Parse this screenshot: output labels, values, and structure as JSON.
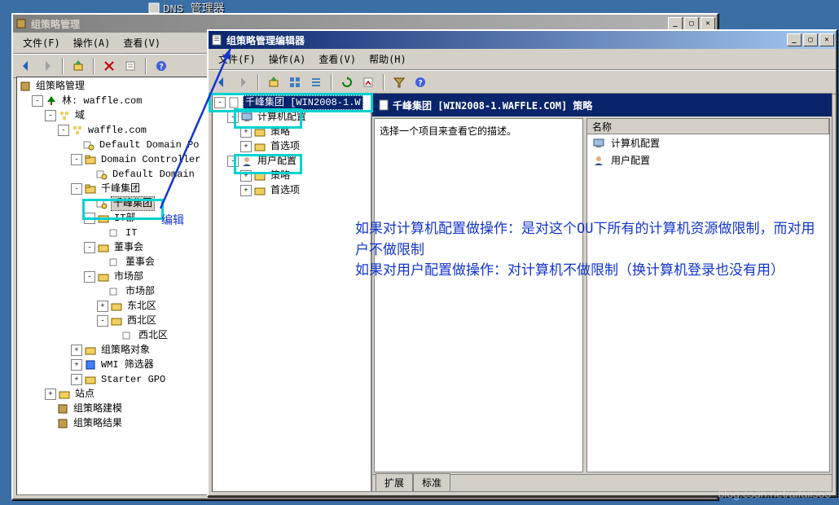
{
  "dns_peek": "DNS 管理器",
  "win_gpmc": {
    "title": "组策略管理",
    "menus": [
      "文件(F)",
      "操作(A)",
      "查看(V)"
    ],
    "tree_root": "组策略管理",
    "forest": "林: waffle.com",
    "domains": "域",
    "domain": "waffle.com",
    "ddp": "Default Domain Po",
    "dc_ou": "Domain Controller",
    "dc_policy": "Default Domain",
    "qf_ou": "千峰集团",
    "qf_gpo": "千峰集团",
    "it_ou": "IT部",
    "it_sub": "IT",
    "dsh_ou": "董事会",
    "dsh_sub": "董事会",
    "scb_ou": "市场部",
    "scb_sub": "市场部",
    "dbq_ou": "东北区",
    "xbq_ou": "西北区",
    "xbq_sub": "西北区",
    "gpo_folder": "组策略对象",
    "wmi": "WMI 筛选器",
    "starter": "Starter GPO",
    "sites": "站点",
    "modeling": "组策略建模",
    "results": "组策略结果"
  },
  "win_gpedit": {
    "title": "组策略管理编辑器",
    "menus": [
      "文件(F)",
      "操作(A)",
      "查看(V)",
      "帮助(H)"
    ],
    "tree_root": "千峰集团 [WIN2008-1.W",
    "cc_node": "计算机配置",
    "cc_policies": "策略",
    "cc_prefs": "首选项",
    "uc_node": "用户配置",
    "uc_policies": "策略",
    "uc_prefs": "首选项",
    "header": "千峰集团 [WIN2008-1.WAFFLE.COM] 策略",
    "desc_text": "选择一个项目来查看它的描述。",
    "col_name": "名称",
    "item_cc": "计算机配置",
    "item_uc": "用户配置",
    "tab_ext": "扩展",
    "tab_std": "标准"
  },
  "annotations": {
    "edit_label": "编辑",
    "text1": "如果对计算机配置做操作：是对这个OU下所有的计算机资源做限制，而对用户不做限制",
    "text2": "如果对用户配置做操作：对计算机不做限制（换计算机登录也没有用）"
  },
  "watermark": "blog.csdn.net/aifails63"
}
